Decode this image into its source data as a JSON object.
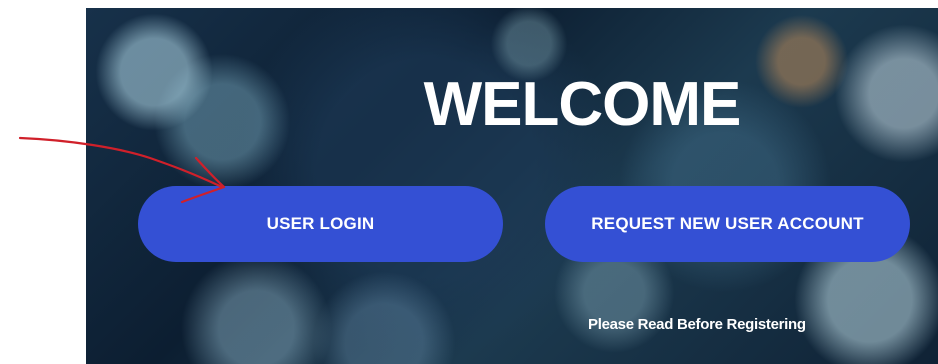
{
  "hero": {
    "title": "WELCOME",
    "login_label": "USER LOGIN",
    "request_label": "REQUEST NEW USER ACCOUNT",
    "note": "Please Read Before Registering"
  },
  "colors": {
    "button": "#3450d4",
    "annotation": "#d0202a",
    "text": "#ffffff"
  },
  "icons": {
    "annotation": "hand-drawn-arrow-icon"
  }
}
